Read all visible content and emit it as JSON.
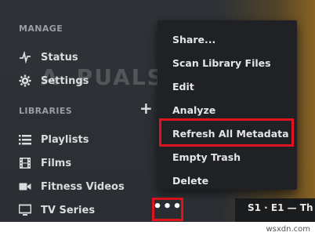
{
  "sidebar": {
    "manage_header": "MANAGE",
    "status_label": "Status",
    "settings_label": "Settings",
    "libraries_header": "LIBRARIES",
    "items": [
      {
        "label": "Playlists",
        "icon": "playlist-icon"
      },
      {
        "label": "Films",
        "icon": "film-icon"
      },
      {
        "label": "Fitness Videos",
        "icon": "video-camera-icon"
      },
      {
        "label": "TV Series",
        "icon": "tv-icon"
      }
    ]
  },
  "context_menu": {
    "items": [
      "Share...",
      "Scan Library Files",
      "Edit",
      "Analyze",
      "Refresh All Metadata",
      "Empty Trash",
      "Delete"
    ]
  },
  "more_button_label": "•••",
  "episode_label": "S1 · E1 — Th",
  "watermark_text": "A PUALS",
  "footer_site": "wsxdn.com",
  "colors": {
    "highlight": "#e0141e",
    "menu_bg": "#1f2124",
    "sidebar_bg": "#2f3337"
  }
}
